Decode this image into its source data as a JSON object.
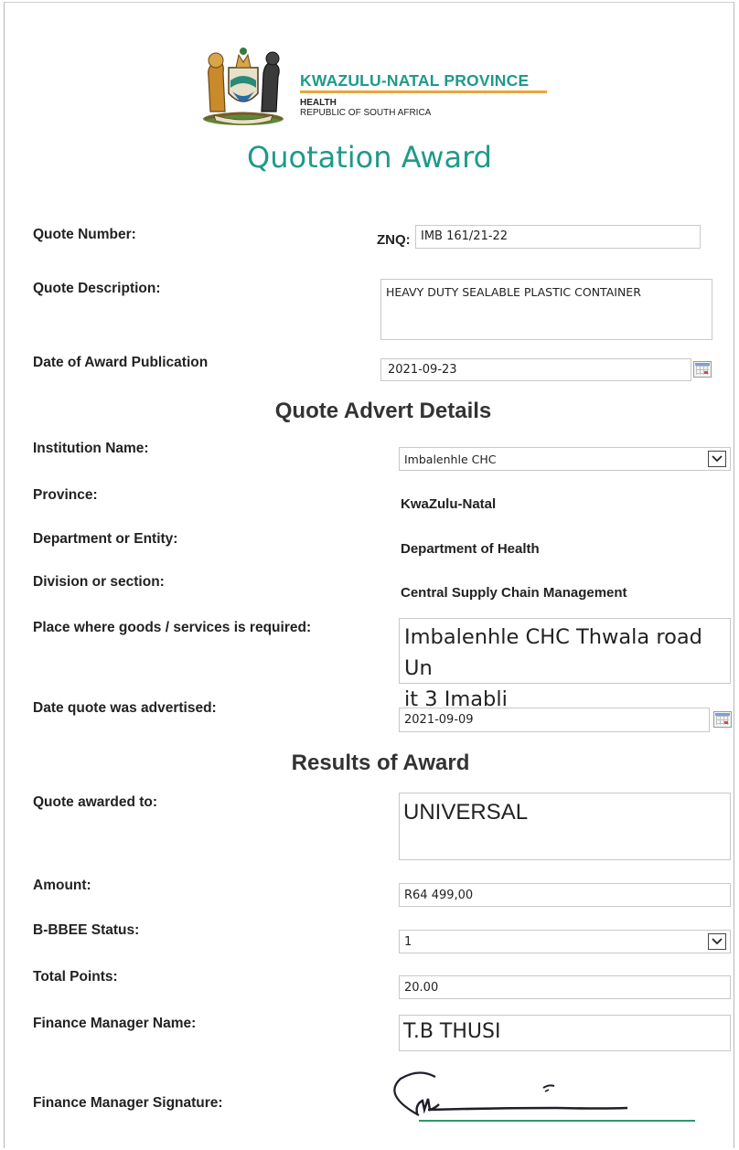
{
  "header": {
    "province": "KWAZULU-NATAL PROVINCE",
    "line1": "HEALTH",
    "line2": "REPUBLIC OF SOUTH AFRICA",
    "crest_icon": "coat-of-arms-icon"
  },
  "title": "Quotation Award",
  "quote": {
    "number_label": "Quote Number:",
    "prefix": "ZNQ:",
    "number": "IMB 161/21-22",
    "description_label": "Quote Description:",
    "description": "HEAVY DUTY SEALABLE PLASTIC CONTAINER",
    "date_label": "Date of Award Publication",
    "date": "2021-09-23"
  },
  "advert": {
    "heading": "Quote Advert Details",
    "institution_label": "Institution Name:",
    "institution": "Imbalenhle CHC",
    "province_label": "Province:",
    "province": "KwaZulu-Natal",
    "department_label": "Department or Entity:",
    "department": "Department of Health",
    "division_label": "Division or section:",
    "division": "Central Supply Chain Management",
    "place_label": "Place where goods /  services is required:",
    "place_line1": "Imbalenhle CHC Thwala road Un",
    "place_line2": "it 3 Imabli",
    "advertised_label": "Date quote was advertised:",
    "advertised": "2021-09-09"
  },
  "results": {
    "heading": "Results of Award",
    "awarded_label": "Quote awarded to:",
    "awarded": "UNIVERSAL",
    "amount_label": "Amount:",
    "amount": "R64 499,00",
    "bbbee_label": "B-BBEE Status:",
    "bbbee": "1",
    "points_label": "Total Points:",
    "points": "20.00",
    "manager_label": "Finance Manager Name:",
    "manager": "T.B THUSI",
    "signature_label": "Finance Manager Signature:"
  },
  "colors": {
    "teal": "#1f9a8a",
    "gold": "#e9a63b",
    "signature_line": "#2a9a6a"
  }
}
